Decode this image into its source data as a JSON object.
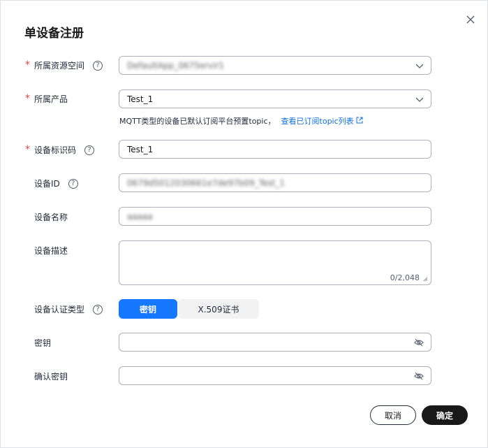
{
  "dialog": {
    "title": "单设备注册",
    "close_icon": "close-icon",
    "cancel_label": "取消",
    "confirm_label": "确定"
  },
  "form": {
    "resource_space": {
      "label": "所属资源空间",
      "required": true,
      "value": "DefaultApp_0675ervir1"
    },
    "product": {
      "label": "所属产品",
      "required": true,
      "value": "Test_1"
    },
    "hint": {
      "text": "MQTT类型的设备已默认订阅平台预置topic，",
      "link": "查看已订阅topic列表"
    },
    "node_id": {
      "label": "设备标识码",
      "required": true,
      "value": "Test_1"
    },
    "device_id": {
      "label": "设备ID",
      "value": "0679d5012030661e7de97b09_Test_1"
    },
    "device_name": {
      "label": "设备名称",
      "value": "aaaaa"
    },
    "description": {
      "label": "设备描述",
      "value": "",
      "counter": "0/2,048"
    },
    "auth_type": {
      "label": "设备认证类型",
      "options": [
        "密钥",
        "X.509证书"
      ],
      "selected": "密钥"
    },
    "secret": {
      "label": "密钥",
      "value": ""
    },
    "confirm_secret": {
      "label": "确认密钥",
      "value": ""
    }
  },
  "colors": {
    "accent": "#1677ff",
    "required": "#e54545",
    "link": "#0f6fde",
    "primary_button": "#191919"
  }
}
